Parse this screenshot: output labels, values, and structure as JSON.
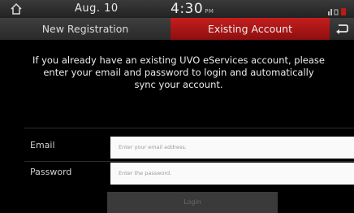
{
  "status": {
    "date": "Aug. 10",
    "time": "4:30",
    "ampm": "PM"
  },
  "tabs": {
    "new_registration": "New Registration",
    "existing_account": "Existing Account"
  },
  "message": "If you already have an existing UVO eServices account, please enter your email and password to login and automatically sync your account.",
  "form": {
    "email_label": "Email",
    "email_placeholder": "Enter your email address.",
    "password_label": "Password",
    "password_placeholder": "Enter the password.",
    "login_label": "Login"
  },
  "colors": {
    "active_tab": "#b01616",
    "background": "#000000"
  },
  "icons": {
    "home": "home-icon",
    "back": "back-arrow-icon",
    "system": "status-icons"
  }
}
